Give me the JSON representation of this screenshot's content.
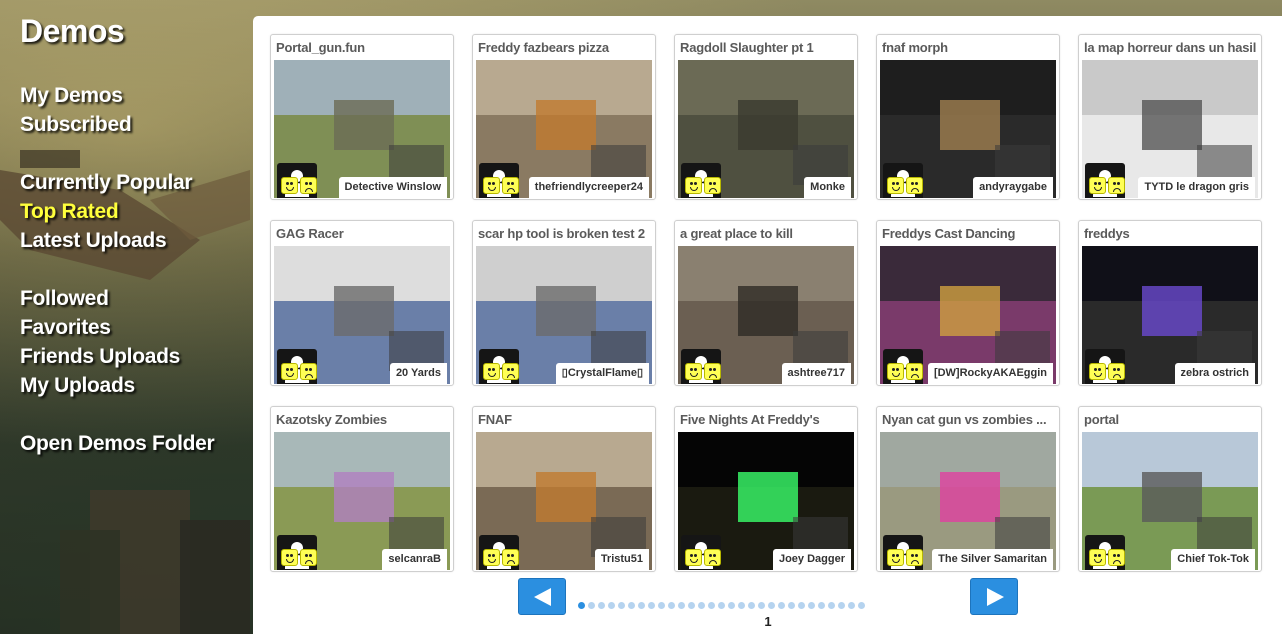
{
  "sidebar": {
    "title": "Demos",
    "links": [
      {
        "label": "My Demos"
      },
      {
        "label": "Subscribed"
      },
      {
        "label": "Currently Popular"
      },
      {
        "label": "Top Rated"
      },
      {
        "label": "Latest Uploads"
      },
      {
        "label": "Followed"
      },
      {
        "label": "Favorites"
      },
      {
        "label": "Friends Uploads"
      },
      {
        "label": "My Uploads"
      },
      {
        "label": "Open Demos Folder"
      }
    ],
    "active_color": "#ffff3c"
  },
  "demos": [
    {
      "title": "Portal_gun.fun",
      "author": "Detective Winslow"
    },
    {
      "title": "Freddy fazbears pizza",
      "author": "thefriendlycreeper24"
    },
    {
      "title": "Ragdoll Slaughter pt 1",
      "author": "Monke"
    },
    {
      "title": "fnaf morph",
      "author": "andyraygabe"
    },
    {
      "title": "la map horreur dans un hasil",
      "author": "TYTD le dragon gris"
    },
    {
      "title": "GAG Racer",
      "author": "20 Yards"
    },
    {
      "title": "scar hp tool is broken test 2",
      "author": "▯CrystalFlame▯"
    },
    {
      "title": "a great place to kill",
      "author": "ashtree717"
    },
    {
      "title": "Freddys Cast Dancing",
      "author": "[DW]RockyAKAEggin"
    },
    {
      "title": "freddys",
      "author": "zebra ostrich"
    },
    {
      "title": "Kazotsky Zombies",
      "author": "selcanraB"
    },
    {
      "title": "FNAF",
      "author": "Tristu51"
    },
    {
      "title": "Five Nights At Freddy's",
      "author": "Joey Dagger"
    },
    {
      "title": "Nyan cat gun vs zombies ...",
      "author": "The Silver Samaritan"
    },
    {
      "title": "portal",
      "author": "Chief Tok-Tok"
    }
  ],
  "pagination": {
    "current_page": "1",
    "dot_count": 29,
    "prev_icon": "left-arrow-icon",
    "next_icon": "right-arrow-icon"
  },
  "colors": {
    "accent": "#2b8fe0",
    "rating_face": "#ffff55"
  }
}
